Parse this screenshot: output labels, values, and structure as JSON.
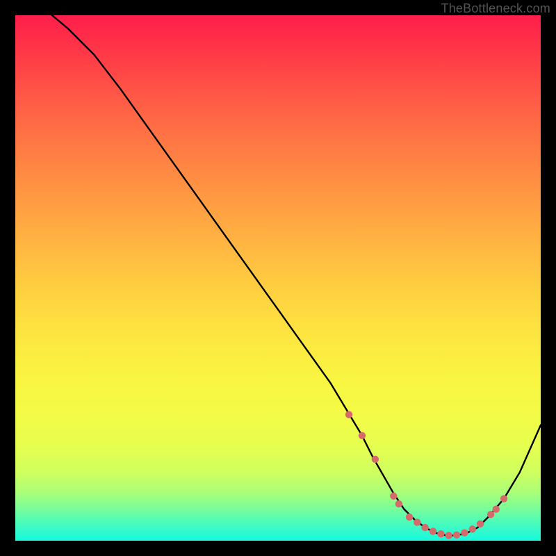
{
  "watermark": "TheBottleneck.com",
  "chart_data": {
    "type": "line",
    "title": "",
    "xlabel": "",
    "ylabel": "",
    "xlim": [
      0,
      100
    ],
    "ylim": [
      0,
      100
    ],
    "series": [
      {
        "name": "bottleneck-curve",
        "x": [
          7,
          10,
          15,
          20,
          25,
          30,
          35,
          40,
          45,
          50,
          55,
          60,
          63,
          66,
          68,
          70,
          72,
          74,
          76,
          78,
          80,
          82,
          84,
          86,
          88,
          90,
          93,
          96,
          100
        ],
        "y": [
          100,
          97.5,
          92.5,
          86,
          79,
          72,
          65,
          58,
          51,
          44,
          37,
          30,
          25,
          20,
          16,
          12.5,
          9,
          6,
          4,
          2.5,
          1.5,
          1,
          1,
          1.5,
          2.5,
          4.5,
          8,
          13,
          22
        ]
      }
    ],
    "dots": {
      "name": "optimal-range-dots",
      "color": "#d46a6a",
      "points": [
        {
          "x": 63.5,
          "y": 24
        },
        {
          "x": 66,
          "y": 20
        },
        {
          "x": 68.5,
          "y": 15.5
        },
        {
          "x": 72,
          "y": 8.5
        },
        {
          "x": 73,
          "y": 7
        },
        {
          "x": 75,
          "y": 4.5
        },
        {
          "x": 76.5,
          "y": 3.5
        },
        {
          "x": 78,
          "y": 2.5
        },
        {
          "x": 79.5,
          "y": 1.8
        },
        {
          "x": 81,
          "y": 1.3
        },
        {
          "x": 82.5,
          "y": 1.0
        },
        {
          "x": 84,
          "y": 1.1
        },
        {
          "x": 85.5,
          "y": 1.5
        },
        {
          "x": 87,
          "y": 2.2
        },
        {
          "x": 88.5,
          "y": 3.2
        },
        {
          "x": 90.5,
          "y": 5.0
        },
        {
          "x": 91.5,
          "y": 6.0
        },
        {
          "x": 93,
          "y": 8.0
        }
      ]
    },
    "gradient_stops": [
      {
        "pos": 0,
        "color": "#ff1e4a"
      },
      {
        "pos": 25,
        "color": "#ff7a44"
      },
      {
        "pos": 55,
        "color": "#ffd740"
      },
      {
        "pos": 80,
        "color": "#edfe48"
      },
      {
        "pos": 100,
        "color": "#17f9de"
      }
    ]
  }
}
